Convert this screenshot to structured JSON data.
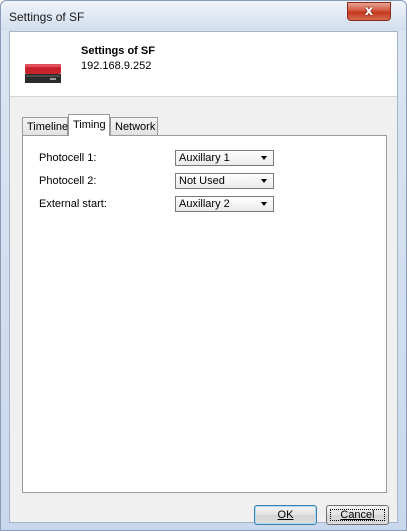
{
  "window": {
    "title": "Settings of SF",
    "close_label": "x"
  },
  "header": {
    "title": "Settings of SF",
    "ip": "192.168.9.252",
    "icon": "device-icon"
  },
  "tabs": [
    {
      "label": "Timeline",
      "active": false
    },
    {
      "label": "Timing",
      "active": true
    },
    {
      "label": "Network",
      "active": false
    }
  ],
  "timing": {
    "rows": [
      {
        "label": "Photocell 1:",
        "value": "Auxillary 1"
      },
      {
        "label": "Photocell 2:",
        "value": "Not Used"
      },
      {
        "label": "External start:",
        "value": "Auxillary 2"
      }
    ]
  },
  "buttons": {
    "ok": "OK",
    "cancel": "Cancel"
  }
}
